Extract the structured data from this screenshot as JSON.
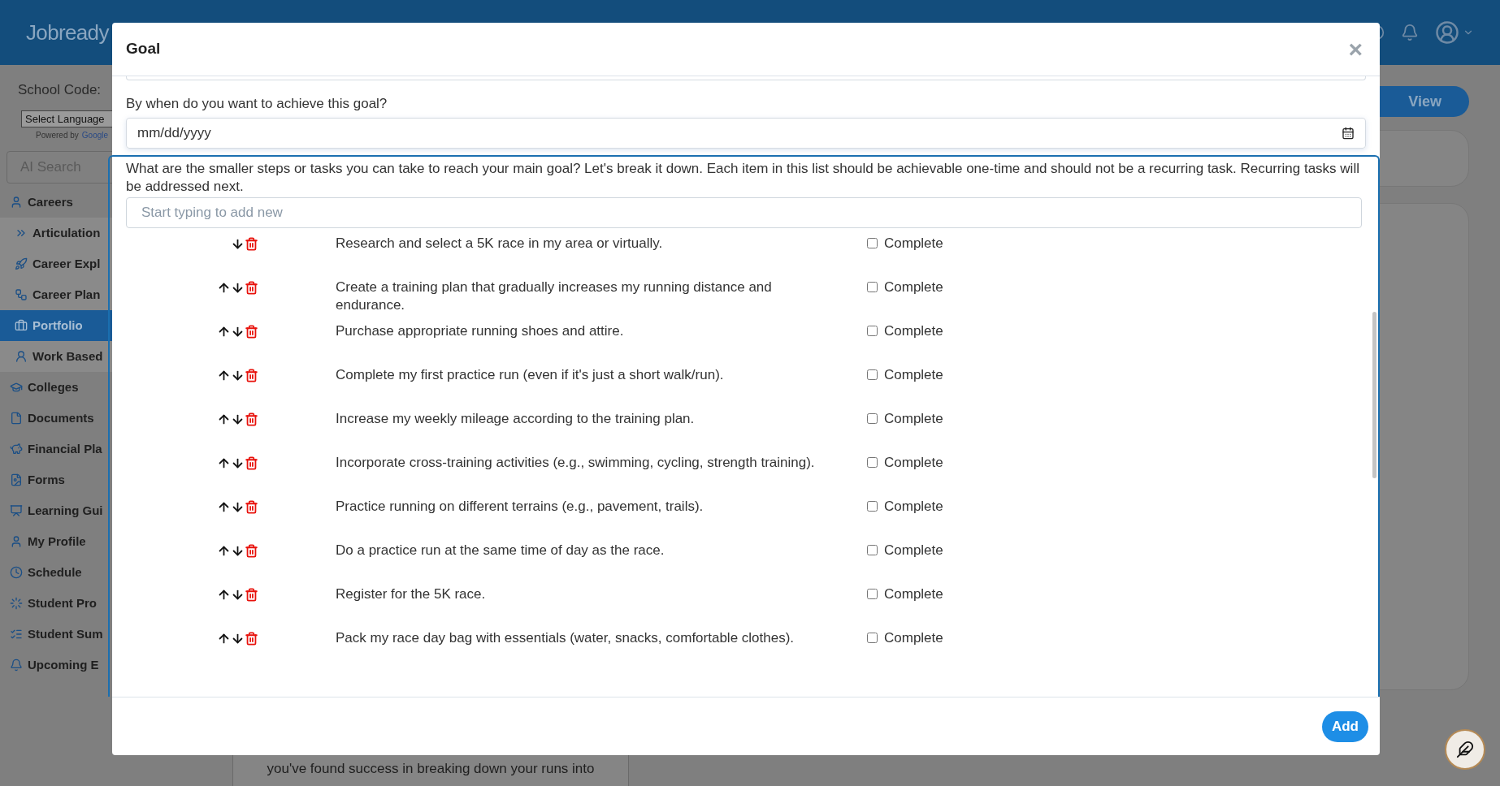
{
  "navbar": {
    "logo": "Jobready"
  },
  "sidebar": {
    "school_code": "School Code:",
    "language_select": "Select Language",
    "powered_by": "Powered by",
    "powered_brand": "Google",
    "search": {
      "placeholder": "AI Search"
    },
    "items": [
      {
        "label": "Careers",
        "selected": false,
        "children": [
          {
            "label": "Articulation",
            "selected": false
          },
          {
            "label": "Career Expl",
            "selected": false
          },
          {
            "label": "Career Plan",
            "selected": false
          },
          {
            "label": "Portfolio",
            "selected": true
          },
          {
            "label": "Work Based",
            "selected": false
          }
        ]
      },
      {
        "label": "Colleges",
        "selected": false
      },
      {
        "label": "Documents",
        "selected": false
      },
      {
        "label": "Financial Pla",
        "selected": false
      },
      {
        "label": "Forms",
        "selected": false
      },
      {
        "label": "Learning Gui",
        "selected": false
      },
      {
        "label": "My Profile",
        "selected": false
      },
      {
        "label": "Schedule",
        "selected": false
      },
      {
        "label": "Student Pro",
        "selected": false
      },
      {
        "label": "Student Sum",
        "selected": false
      },
      {
        "label": "Upcoming E",
        "selected": false
      }
    ]
  },
  "background": {
    "view_button": "View",
    "text_lines": [
      "you've found success in breaking down your runs into"
    ]
  },
  "modal": {
    "title": "Goal",
    "close": "×",
    "date_label": "By when do you want to achieve this goal?",
    "date_placeholder": "mm/dd/yyyy",
    "steps_prompt": "What are the smaller steps or tasks you can take to reach your main goal? Let's break it down. Each item in this list should be achievable one-time and should not be a recurring task. Recurring tasks will be addressed next.",
    "new_step": {
      "placeholder": "Start typing to add new"
    },
    "steps": [
      {
        "text": "Research and select a 5K race in my area or virtually.",
        "can_move_up": false,
        "complete_label": "Complete",
        "checked": false
      },
      {
        "text": "Create a training plan that gradually increases my running distance and endurance.",
        "can_move_up": true,
        "complete_label": "Complete",
        "checked": false
      },
      {
        "text": "Purchase appropriate running shoes and attire.",
        "can_move_up": true,
        "complete_label": "Complete",
        "checked": false
      },
      {
        "text": "Complete my first practice run (even if it's just a short walk/run).",
        "can_move_up": true,
        "complete_label": "Complete",
        "checked": false
      },
      {
        "text": "Increase my weekly mileage according to the training plan.",
        "can_move_up": true,
        "complete_label": "Complete",
        "checked": false
      },
      {
        "text": "Incorporate cross-training activities (e.g., swimming, cycling, strength training).",
        "can_move_up": true,
        "complete_label": "Complete",
        "checked": false
      },
      {
        "text": "Practice running on different terrains (e.g., pavement, trails).",
        "can_move_up": true,
        "complete_label": "Complete",
        "checked": false
      },
      {
        "text": "Do a practice run at the same time of day as the race.",
        "can_move_up": true,
        "complete_label": "Complete",
        "checked": false
      },
      {
        "text": "Register for the 5K race.",
        "can_move_up": true,
        "complete_label": "Complete",
        "checked": false
      },
      {
        "text": "Pack my race day bag with essentials (water, snacks, comfortable clothes).",
        "can_move_up": true,
        "complete_label": "Complete",
        "checked": false
      }
    ],
    "add_button": "Add"
  }
}
